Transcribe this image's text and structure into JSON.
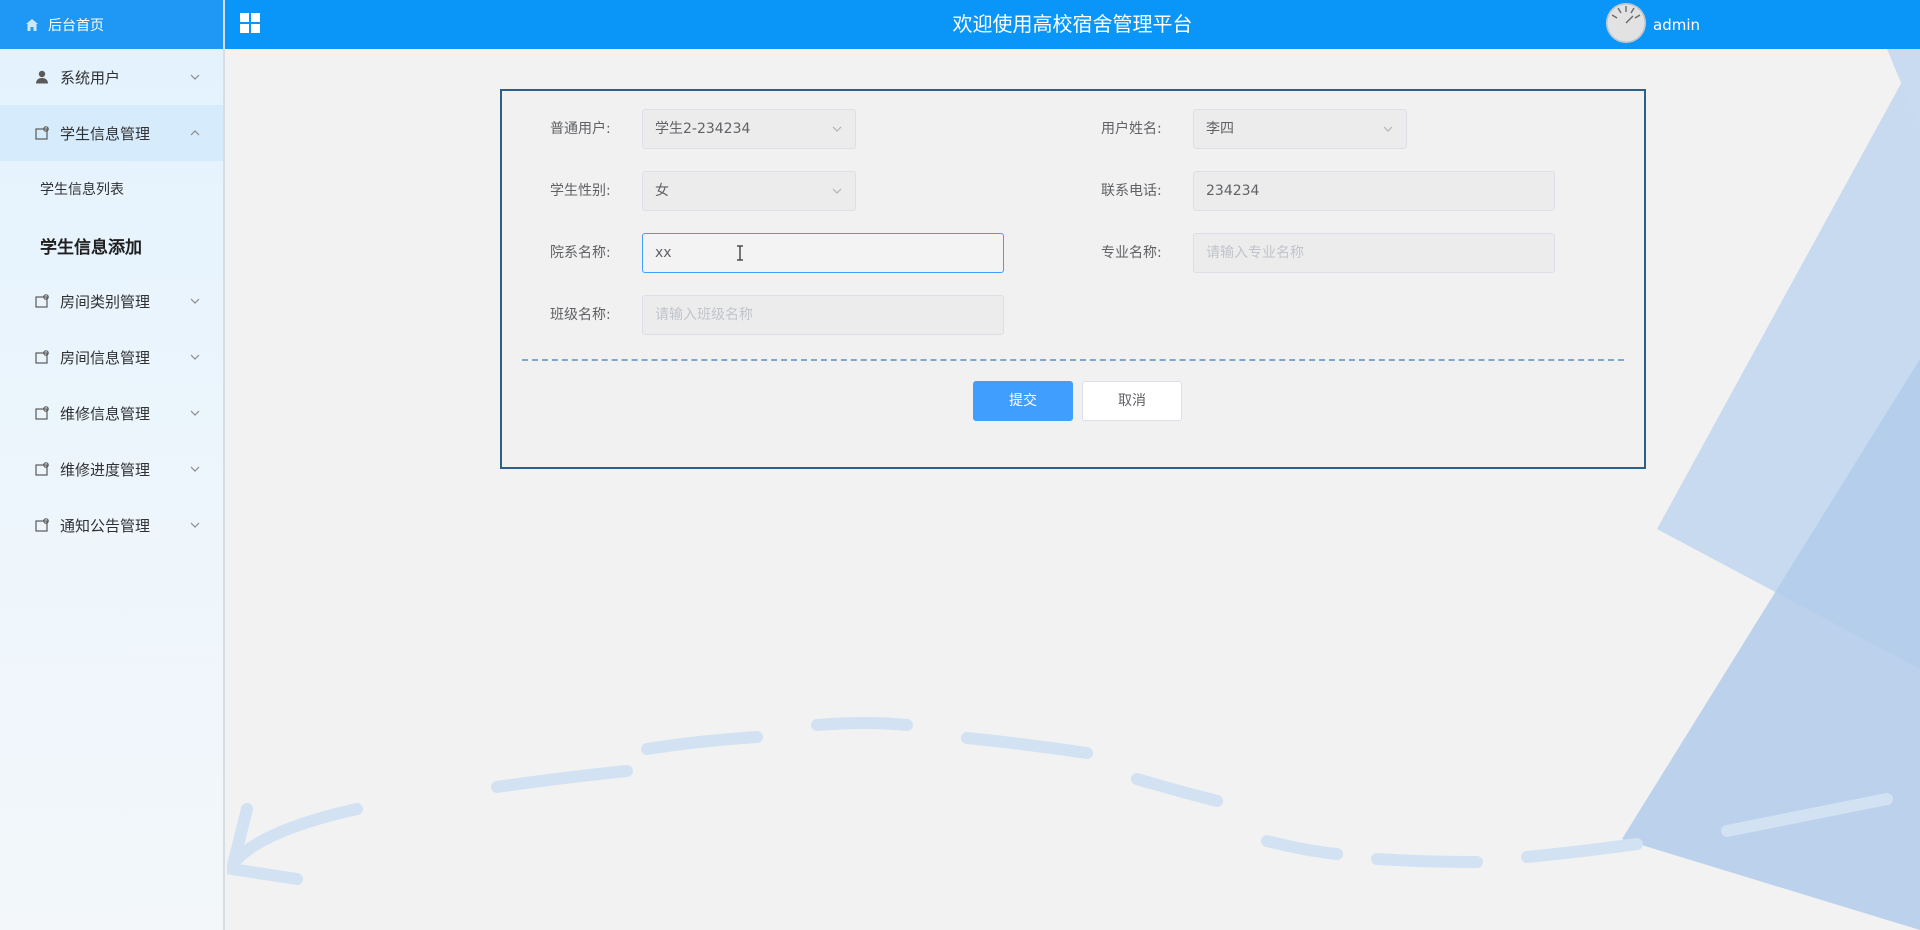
{
  "brand": {
    "label": "后台首页",
    "icon": "home-icon"
  },
  "header": {
    "title": "欢迎使用高校宿舍管理平台",
    "user": "admin",
    "menu_icon": "grid-icon"
  },
  "sidebar": {
    "items": [
      {
        "label": "系统用户",
        "icon": "user-icon",
        "expanded": false
      },
      {
        "label": "学生信息管理",
        "icon": "folder-icon",
        "expanded": true,
        "children": [
          {
            "label": "学生信息列表",
            "active": false
          },
          {
            "label": "学生信息添加",
            "active": true
          }
        ]
      },
      {
        "label": "房间类别管理",
        "icon": "folder-icon",
        "expanded": false
      },
      {
        "label": "房间信息管理",
        "icon": "folder-icon",
        "expanded": false
      },
      {
        "label": "维修信息管理",
        "icon": "folder-icon",
        "expanded": false
      },
      {
        "label": "维修进度管理",
        "icon": "folder-icon",
        "expanded": false
      },
      {
        "label": "通知公告管理",
        "icon": "folder-icon",
        "expanded": false
      }
    ]
  },
  "form": {
    "user_label": "普通用户:",
    "user_value": "学生2-234234",
    "name_label": "用户姓名:",
    "name_value": "李四",
    "gender_label": "学生性别:",
    "gender_value": "女",
    "phone_label": "联系电话:",
    "phone_value": "234234",
    "dept_label": "院系名称:",
    "dept_value": "xx",
    "major_label": "专业名称:",
    "major_placeholder": "请输入专业名称",
    "class_label": "班级名称:",
    "class_placeholder": "请输入班级名称",
    "submit_label": "提交",
    "cancel_label": "取消"
  },
  "colors": {
    "header": "#0a96f8",
    "primary": "#409eff",
    "card_border": "#2c5f8a"
  }
}
